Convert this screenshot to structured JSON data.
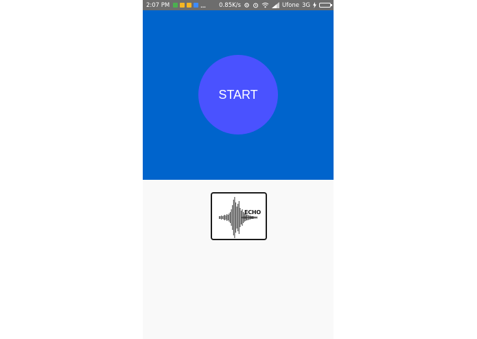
{
  "status_bar": {
    "time": "2:07 PM",
    "dots": "...",
    "speed": "0.85K/s",
    "carrier": "Ufone",
    "network": "3G",
    "notification_colors": [
      "#4caf50",
      "#f5b623",
      "#f5b623",
      "#3d8bfd"
    ]
  },
  "main": {
    "start_label": "START",
    "panel_color": "#0064cc",
    "button_color": "#4a52ff"
  },
  "logo": {
    "text": "ECHO"
  }
}
